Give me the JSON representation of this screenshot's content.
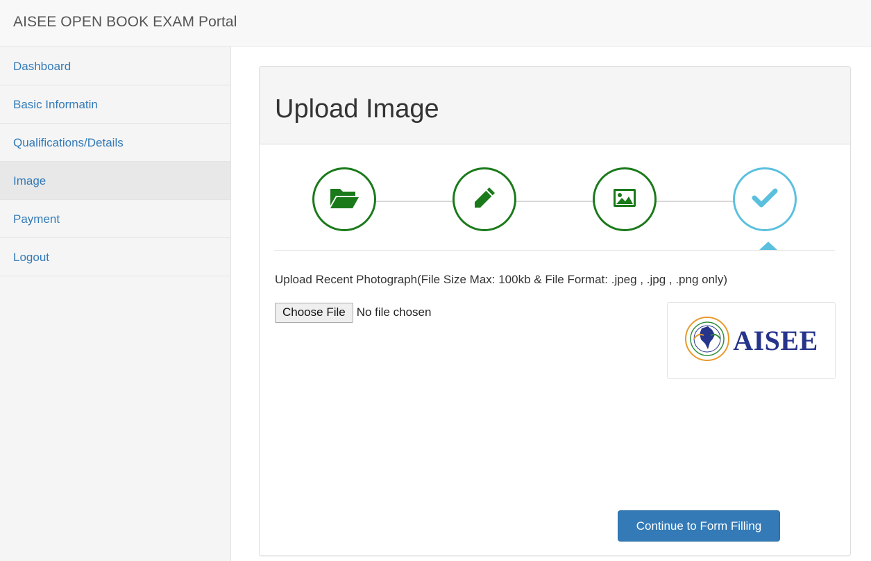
{
  "app": {
    "title": "AISEE OPEN BOOK EXAM Portal"
  },
  "sidebar": {
    "items": [
      {
        "label": "Dashboard",
        "active": false
      },
      {
        "label": "Basic Informatin",
        "active": false
      },
      {
        "label": "Qualifications/Details",
        "active": false
      },
      {
        "label": "Image",
        "active": true
      },
      {
        "label": "Payment",
        "active": false
      },
      {
        "label": "Logout",
        "active": false
      }
    ]
  },
  "panel": {
    "title": "Upload Image",
    "wizard": {
      "steps": [
        {
          "icon": "folder-open-icon",
          "state": "complete"
        },
        {
          "icon": "pencil-icon",
          "state": "complete"
        },
        {
          "icon": "image-icon",
          "state": "complete"
        },
        {
          "icon": "check-icon",
          "state": "current"
        }
      ]
    },
    "upload_label": "Upload Recent Photograph(File Size Max: 100kb & File Format: .jpeg , .jpg , .png only)",
    "file_input": {
      "button_label": "Choose File",
      "status": "No file chosen"
    },
    "logo": {
      "text": "AISEE"
    },
    "continue_label": "Continue to Form Filling"
  },
  "colors": {
    "link": "#337ab7",
    "step_complete": "#1a7a1a",
    "step_current": "#5bc0de",
    "primary_button": "#337ab7"
  }
}
